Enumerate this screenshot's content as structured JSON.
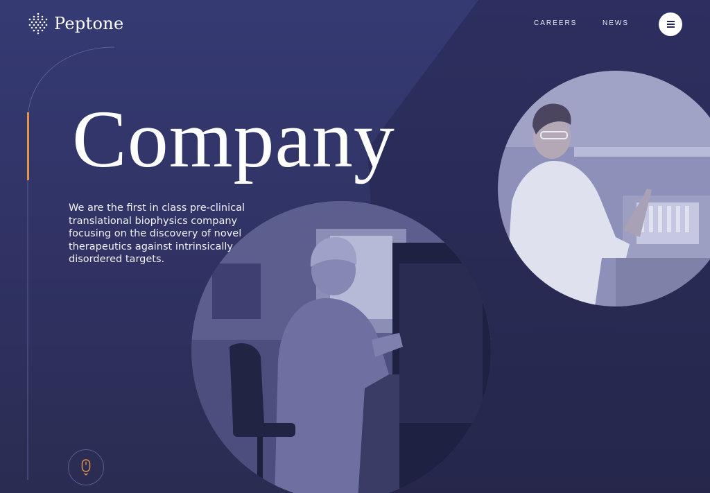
{
  "brand": {
    "name": "Peptone",
    "icon": "dot-grid-logo-icon"
  },
  "nav": {
    "links": [
      {
        "label": "CAREERS"
      },
      {
        "label": "NEWS"
      }
    ],
    "menu_icon": "hamburger-menu-icon"
  },
  "hero": {
    "title": "Company",
    "intro": "We are the first in class pre-clinical translational biophysics company focusing on the discovery of novel therapeutics against intrinsically disordered targets."
  },
  "images": {
    "lab_large": "scientist-at-fume-hood-photo",
    "lab_small": "scientist-with-pipette-photo"
  },
  "scroll": {
    "icon": "mouse-scroll-icon"
  },
  "colors": {
    "background": "#353a73",
    "accent": "#e3964a",
    "text": "#ffffff"
  }
}
